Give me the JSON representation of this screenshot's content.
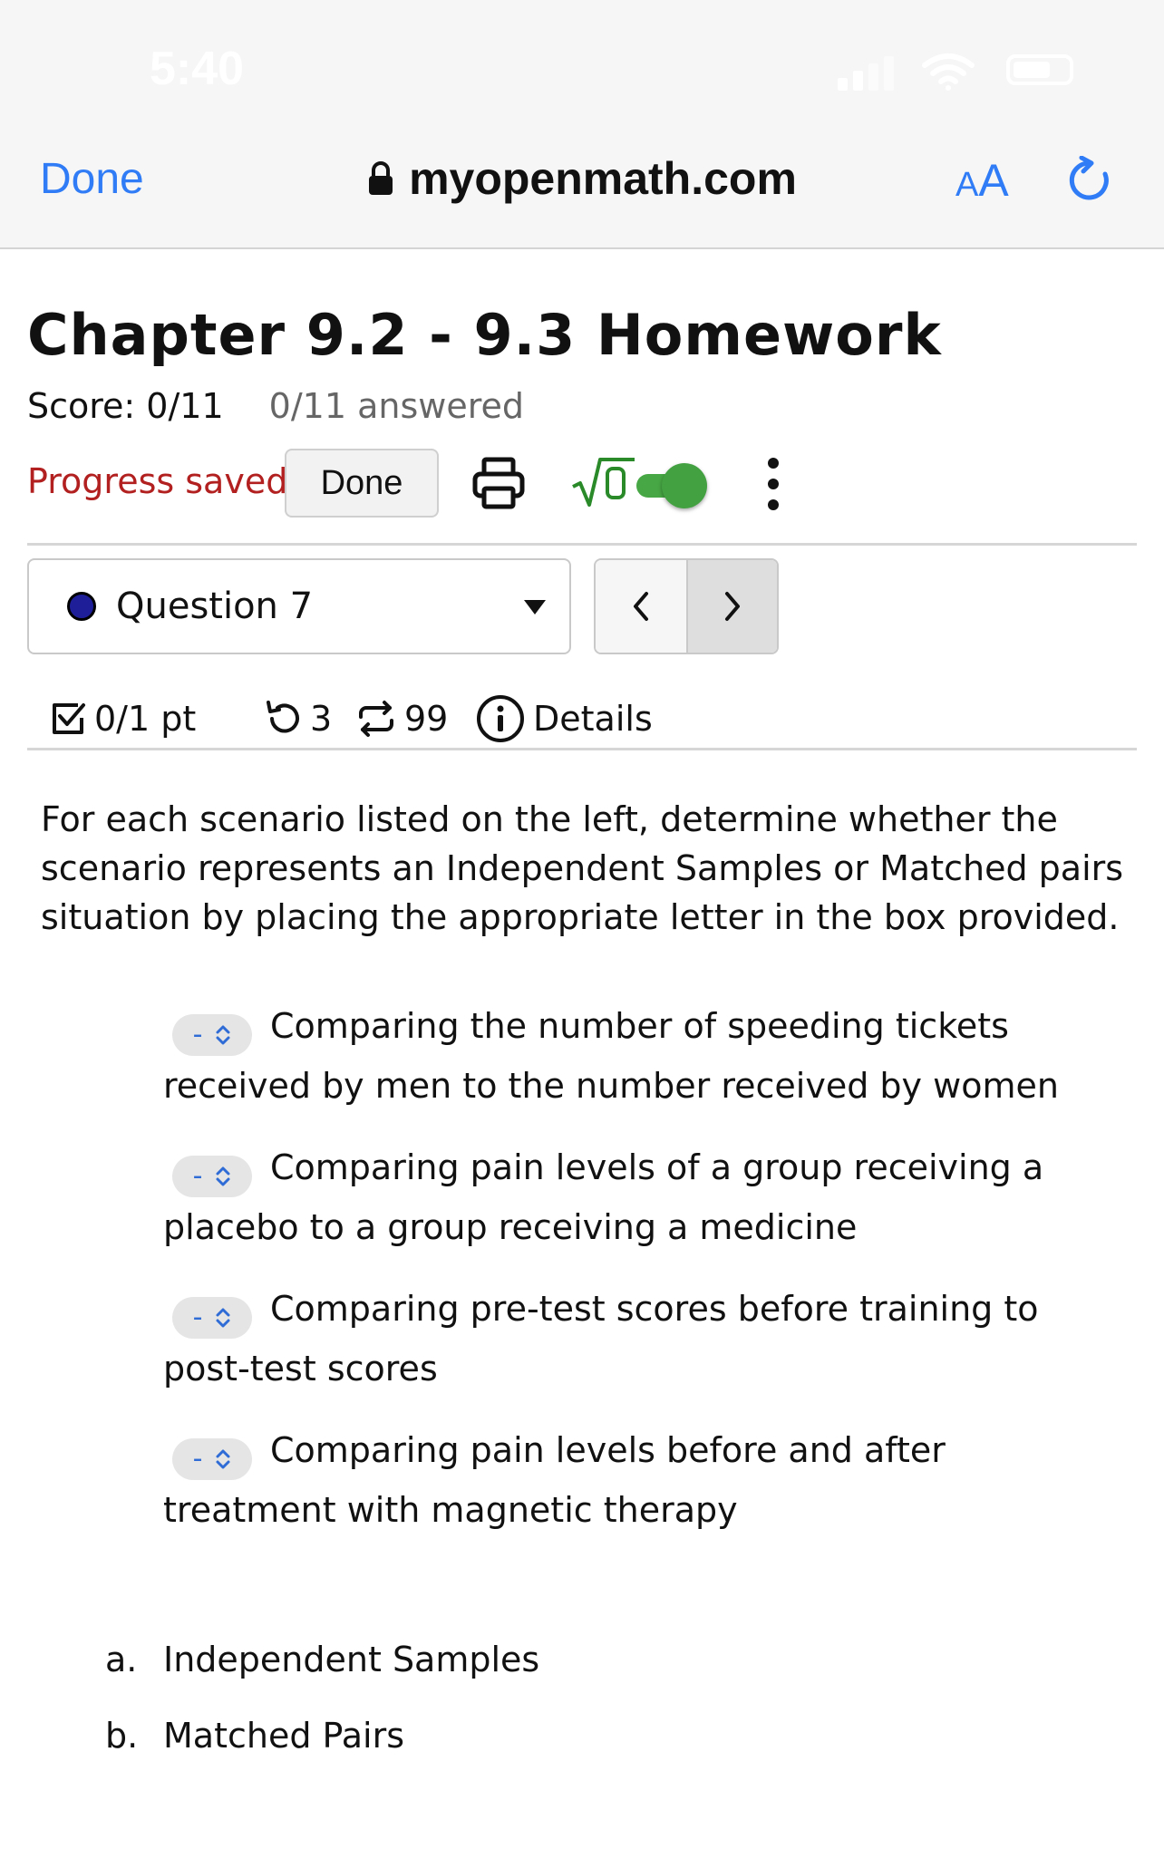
{
  "status_bar": {
    "time": "5:40"
  },
  "browser": {
    "done_label": "Done",
    "url": "myopenmath.com",
    "text_size_small": "A",
    "text_size_large": "A"
  },
  "assessment": {
    "title": "Chapter 9.2 - 9.3 Homework",
    "score": "Score: 0/11",
    "answered": "0/11 answered",
    "progress_status": "Progress saved",
    "done_button": "Done",
    "math_toggle": {
      "on": true,
      "color": "#43a141"
    }
  },
  "question_nav": {
    "current": "Question 7",
    "status_color": "#1e1e99"
  },
  "question_meta": {
    "points": "0/1 pt",
    "retries": "3",
    "attempts": "99",
    "details_label": "Details"
  },
  "question": {
    "prompt": "For each scenario listed on the left, determine whether the scenario represents an Independent Samples or Matched pairs situation by placing the appropriate letter in the box provided.",
    "scenarios": [
      {
        "selected": "-",
        "text": "Comparing the number of speeding tickets received by men to the number received by women"
      },
      {
        "selected": "-",
        "text": "Comparing pain levels of a group receiving a placebo to a group receiving a medicine"
      },
      {
        "selected": "-",
        "text": "Comparing pre-test scores before training to post-test scores"
      },
      {
        "selected": "-",
        "text": "Comparing pain levels before and after treatment with magnetic therapy"
      }
    ],
    "choices": [
      {
        "letter": "a.",
        "text": "Independent Samples"
      },
      {
        "letter": "b.",
        "text": "Matched Pairs"
      }
    ]
  },
  "colors": {
    "link_blue": "#2f7cf6",
    "saved_red": "#b22020"
  }
}
